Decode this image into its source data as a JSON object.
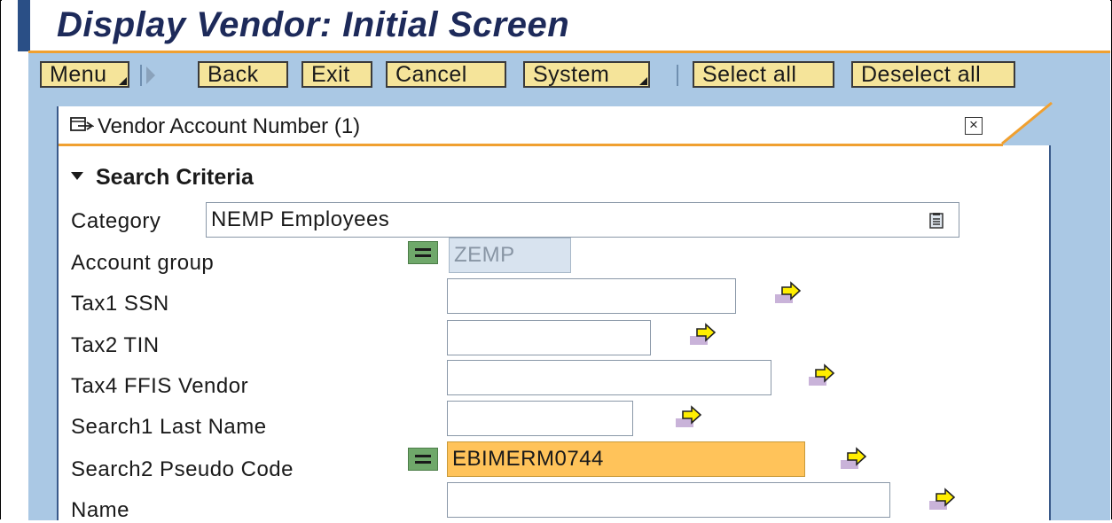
{
  "title": "Display Vendor: Initial Screen",
  "toolbar": {
    "menu": "Menu",
    "back": "Back",
    "exit": "Exit",
    "cancel": "Cancel",
    "system": "System",
    "select_all": "Select all",
    "deselect_all": "Deselect all"
  },
  "dialog": {
    "title": "Vendor Account Number (1)",
    "close_icon": "close-icon",
    "section": "Search Criteria"
  },
  "fields": [
    {
      "label": "Category",
      "value": "NEMP Employees"
    },
    {
      "label": "Account group",
      "value": "ZEMP",
      "operator": "equals",
      "readonly": true
    },
    {
      "label": "Tax1 SSN",
      "value": ""
    },
    {
      "label": "Tax2 TIN",
      "value": ""
    },
    {
      "label": "Tax4 FFIS Vendor",
      "value": ""
    },
    {
      "label": "Search1 Last Name",
      "value": ""
    },
    {
      "label": "Search2 Pseudo Code",
      "value": "EBIMERM0744",
      "operator": "equals",
      "highlighted": true
    },
    {
      "label": "Name",
      "value": ""
    }
  ],
  "colors": {
    "title_text": "#1d2a5a",
    "toolbar_bg": "#aac8e4",
    "button_bg": "#f5e49a",
    "accent_orange": "#f0a030",
    "highlight_field": "#ffc35a",
    "equals_icon": "#6fa86a"
  }
}
